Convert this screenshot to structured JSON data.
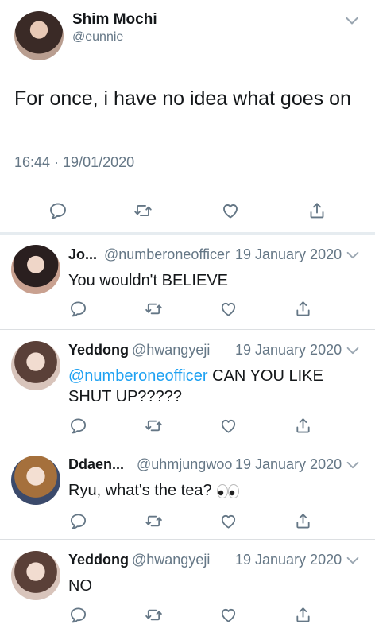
{
  "main_tweet": {
    "author_name": "Shim Mochi",
    "author_handle": "@eunnie",
    "text": "For once, i have no idea what goes on",
    "timestamp": "16:44 · 19/01/2020"
  },
  "replies": [
    {
      "name": "Jo...",
      "handle": "@numberoneofficer",
      "date": "19 January 2020",
      "text": "You wouldn't BELIEVE"
    },
    {
      "name": "Yeddong",
      "handle": "@hwangyeji",
      "date": "19 January 2020",
      "mention": "@numberoneofficer",
      "text": " CAN YOU LIKE SHUT UP?????"
    },
    {
      "name": "Ddaen...",
      "handle": "@uhmjungwoo",
      "date": "19 January 2020",
      "text": "Ryu, what's the tea?",
      "emoji": "eyes-emoji"
    },
    {
      "name": "Yeddong",
      "handle": "@hwangyeji",
      "date": "19 January 2020",
      "text": "NO"
    }
  ],
  "icons": [
    "comment-icon",
    "retweet-icon",
    "like-icon",
    "share-icon",
    "chevron-down-icon"
  ],
  "colors": {
    "accent": "#1da1f2",
    "secondary_text": "#657786",
    "icon": "#657786",
    "divider": "#dcdfe2"
  }
}
